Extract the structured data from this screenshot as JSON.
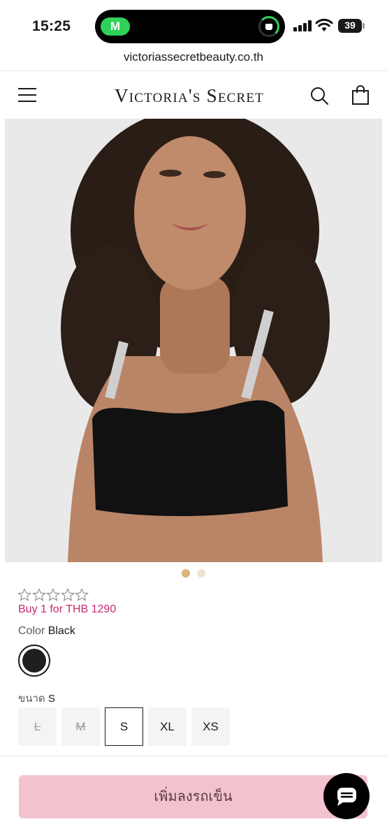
{
  "status_bar": {
    "time": "15:25",
    "app_indicator": "M",
    "battery_level": "39",
    "icons": [
      "signal-icon",
      "wifi-icon",
      "battery-icon",
      "activity-ring-icon"
    ]
  },
  "browser": {
    "url": "victoriassecretbeauty.co.th"
  },
  "header": {
    "logo": "Victoria's Secret",
    "icons": [
      "menu-icon",
      "search-icon",
      "shopping-bag-icon"
    ]
  },
  "carousel": {
    "total": 2,
    "active_index": 0
  },
  "product": {
    "rating_stars": 0,
    "rating_max": 5,
    "promo": "Buy 1 for THB 1290",
    "color_label": "Color",
    "color_value": "Black",
    "swatch_color": "#1e1e1e",
    "size_label": "ขนาด",
    "size_value": "S",
    "sizes": [
      {
        "label": "L",
        "available": false
      },
      {
        "label": "M",
        "available": false
      },
      {
        "label": "S",
        "available": true,
        "selected": true
      },
      {
        "label": "XL",
        "available": true
      },
      {
        "label": "XS",
        "available": true
      }
    ]
  },
  "actions": {
    "add_to_bag": "เพิ่มลงรถเข็น"
  },
  "colors": {
    "promo": "#c8286f",
    "add_to_bag_bg": "#f2c3cf",
    "dot_active": "#d6b67a",
    "dot_inactive": "#efe3cc"
  }
}
